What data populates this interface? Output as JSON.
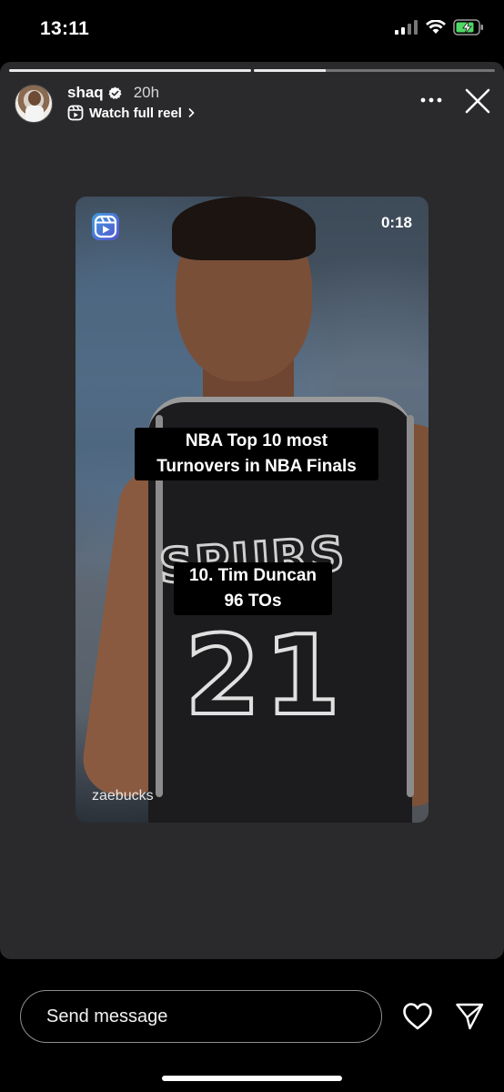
{
  "status_bar": {
    "time": "13:11",
    "icons": [
      "signal-icon",
      "wifi-icon",
      "battery-charging-icon"
    ],
    "battery_color": "#4cd964"
  },
  "story": {
    "username": "shaq",
    "verified": true,
    "time_ago": "20h",
    "watch_label": "Watch full reel",
    "background": "#2a2a2c",
    "progress_segments": 2
  },
  "reel": {
    "duration": "0:18",
    "caption_lines": [
      "NBA Top 10 most",
      "Turnovers in NBA Finals"
    ],
    "rank_lines": [
      "10. Tim Duncan",
      "96 TOs"
    ],
    "jersey_text": "SPURS",
    "jersey_number": "21",
    "watermark": "zaebucks"
  },
  "composer": {
    "placeholder": "Send message"
  },
  "colors": {
    "accent_reel_gradient": [
      "#5851db",
      "#3fa9f5"
    ]
  }
}
